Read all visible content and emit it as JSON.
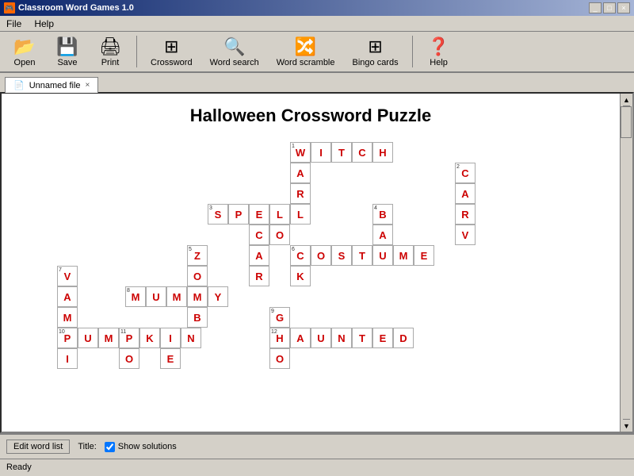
{
  "titleBar": {
    "title": "Classroom Word Games 1.0",
    "icon": "🎮",
    "buttons": [
      "_",
      "□",
      "×"
    ]
  },
  "menuBar": {
    "items": [
      "File",
      "Help"
    ]
  },
  "toolbar": {
    "buttons": [
      {
        "name": "open",
        "label": "Open",
        "icon": "📂"
      },
      {
        "name": "save",
        "label": "Save",
        "icon": "💾"
      },
      {
        "name": "print",
        "label": "Print",
        "icon": "🖨"
      },
      {
        "name": "crossword",
        "label": "Crossword",
        "icon": "⊞"
      },
      {
        "name": "word-search",
        "label": "Word search",
        "icon": "🔍"
      },
      {
        "name": "word-scramble",
        "label": "Word scramble",
        "icon": "🔀"
      },
      {
        "name": "bingo-cards",
        "label": "Bingo cards",
        "icon": "⊞"
      },
      {
        "name": "help",
        "label": "Help",
        "icon": "❓"
      }
    ]
  },
  "tabs": [
    {
      "label": "Unnamed file",
      "active": true
    }
  ],
  "puzzle": {
    "title": "Halloween Crossword Puzzle"
  },
  "bottomBar": {
    "editWordListBtn": "Edit word list",
    "titleLabel": "Title:",
    "showSolutionsLabel": "Show solutions"
  },
  "statusBar": {
    "text": "Ready"
  },
  "cells": {
    "WITCH": [
      {
        "letter": "W",
        "col": 16,
        "row": 1,
        "num": "1"
      },
      {
        "letter": "I",
        "col": 17,
        "row": 1
      },
      {
        "letter": "T",
        "col": 18,
        "row": 1
      },
      {
        "letter": "C",
        "col": 19,
        "row": 1
      },
      {
        "letter": "H",
        "col": 20,
        "row": 1
      }
    ]
  }
}
